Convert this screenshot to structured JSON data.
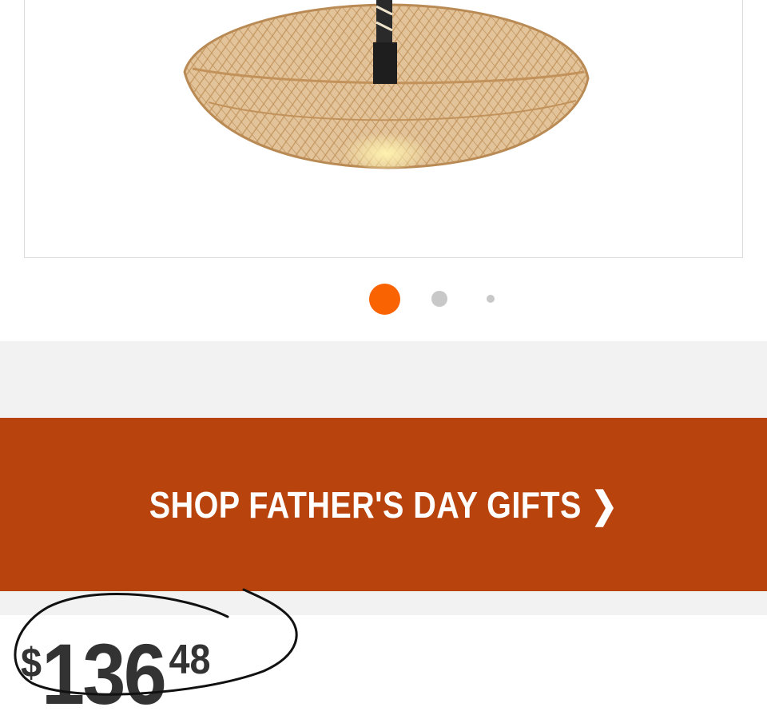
{
  "product_image": {
    "alt_icon": "rattan-pendant-lamp-image",
    "carousel": {
      "count": 3,
      "active_index": 0
    }
  },
  "promo": {
    "label": "SHOP FATHER'S DAY GIFTS",
    "chevron": "❯"
  },
  "price": {
    "currency": "$",
    "dollars": "136",
    "cents": "48"
  },
  "colors": {
    "accent": "#f96302",
    "banner": "#b9430c",
    "price_text": "#333333",
    "dot_inactive": "#c8c8c8"
  }
}
